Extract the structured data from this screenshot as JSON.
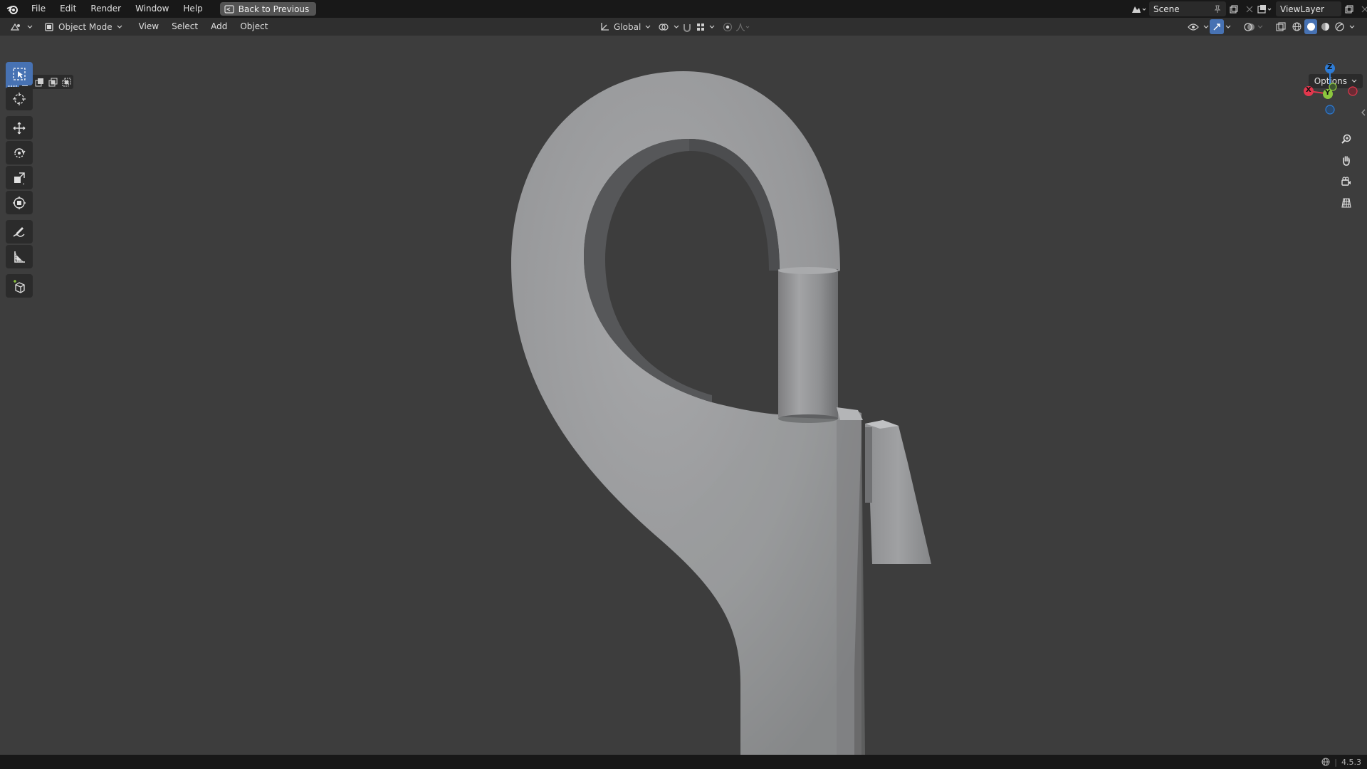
{
  "topbar": {
    "menu": [
      "File",
      "Edit",
      "Render",
      "Window",
      "Help"
    ],
    "back_button": "Back to Previous",
    "scene": "Scene",
    "view_layer": "ViewLayer"
  },
  "header": {
    "mode": "Object Mode",
    "menu": [
      "View",
      "Select",
      "Add",
      "Object"
    ],
    "transform_orientation": "Global",
    "options": "Options"
  },
  "toolbar": {
    "tools": [
      "select-box",
      "cursor",
      "move",
      "rotate",
      "scale",
      "transform",
      "annotate",
      "measure",
      "add-cube"
    ],
    "active": "select-box"
  },
  "gizmo": {
    "z": "Z",
    "x": "X",
    "y": "Y"
  },
  "status": {
    "version": "4.5.3"
  },
  "colors": {
    "accent": "#4772b3",
    "axis_x": "#e2374d",
    "axis_y": "#8cc63e",
    "axis_z": "#2e7cd6"
  }
}
